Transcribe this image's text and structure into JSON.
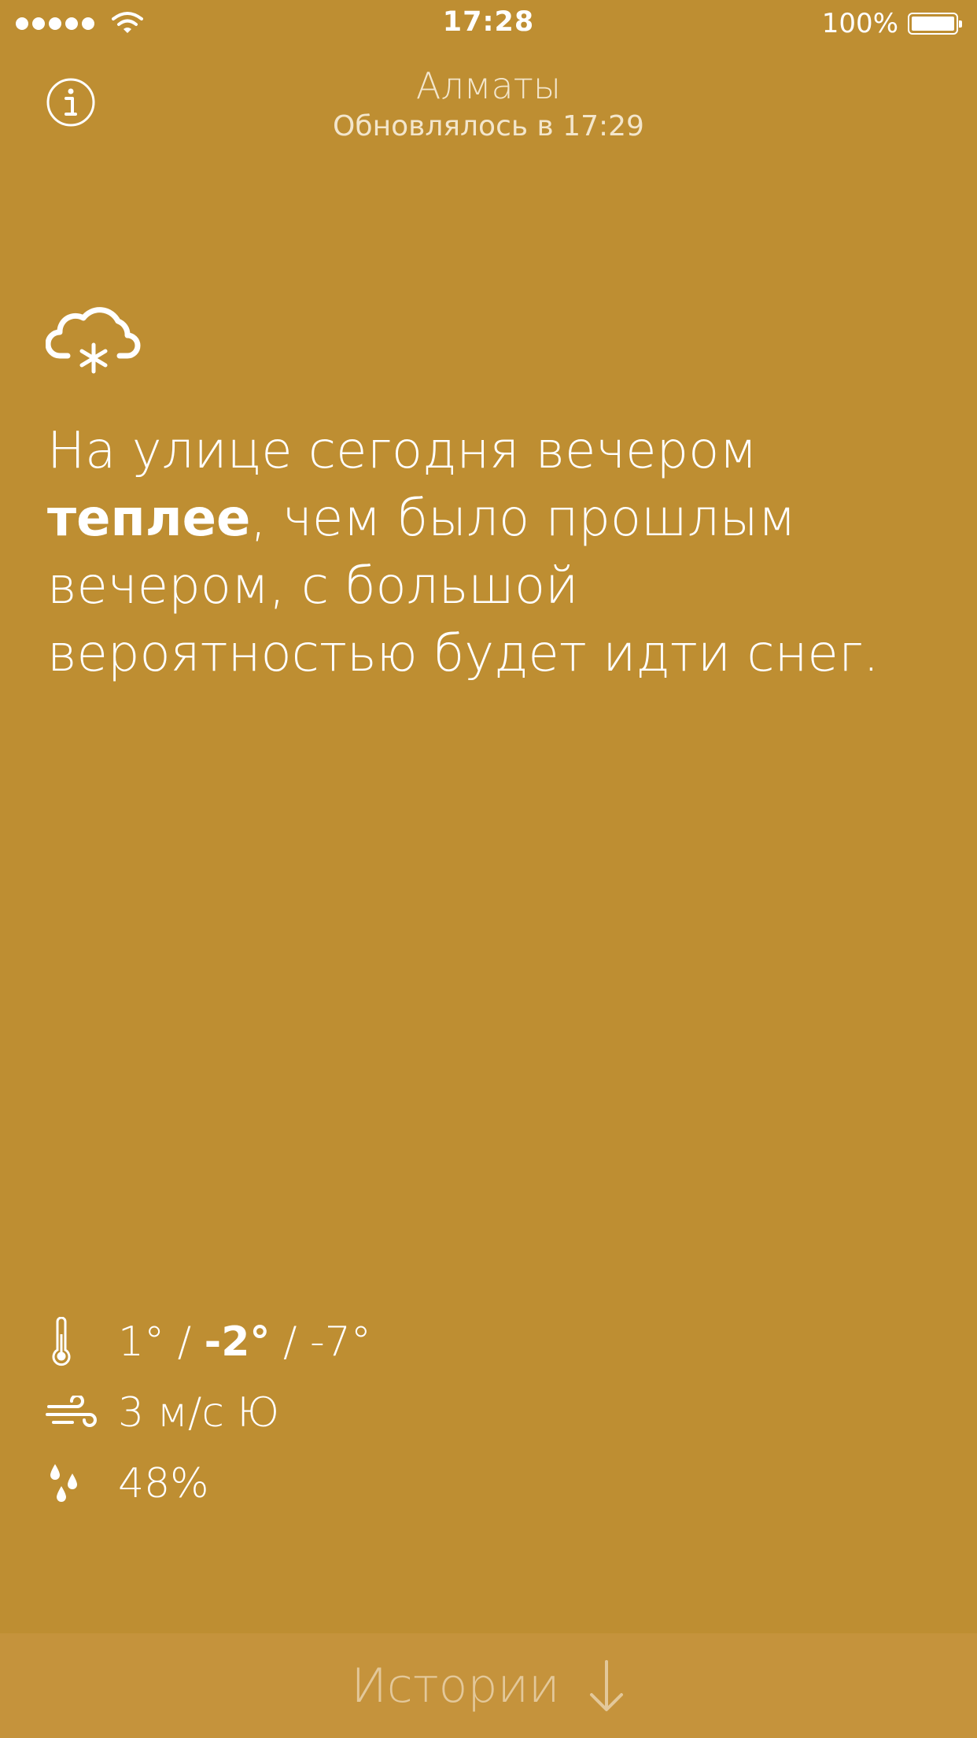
{
  "status_bar": {
    "time": "17:28",
    "battery": "100%",
    "signal_bars": 5
  },
  "header": {
    "city": "Алматы",
    "updated": "Обновлялось в 17:29"
  },
  "icons": {
    "info": "info-icon",
    "weather": "cloud-snow-icon",
    "temperature": "thermometer-icon",
    "wind": "wind-icon",
    "precipitation": "raindrops-icon",
    "stories": "arrow-down-icon"
  },
  "summary": {
    "line1": "На улице сегодня вечером",
    "emphasis": "теплее",
    "line2_rest": ", чем было прошлым",
    "line3": "вечером, с большой",
    "line4": "вероятностью будет идти снег."
  },
  "details": {
    "temp_high": "1°",
    "temp_sep1": " / ",
    "temp_current": "-2°",
    "temp_sep2": " / ",
    "temp_low": "-7°",
    "wind": "3 м/с Ю",
    "precipitation": "48%"
  },
  "stories": {
    "label": "Истории"
  },
  "colors": {
    "background": "#BE8E32",
    "stories_bar": "#C5933C",
    "text": "#FFFFFF"
  }
}
